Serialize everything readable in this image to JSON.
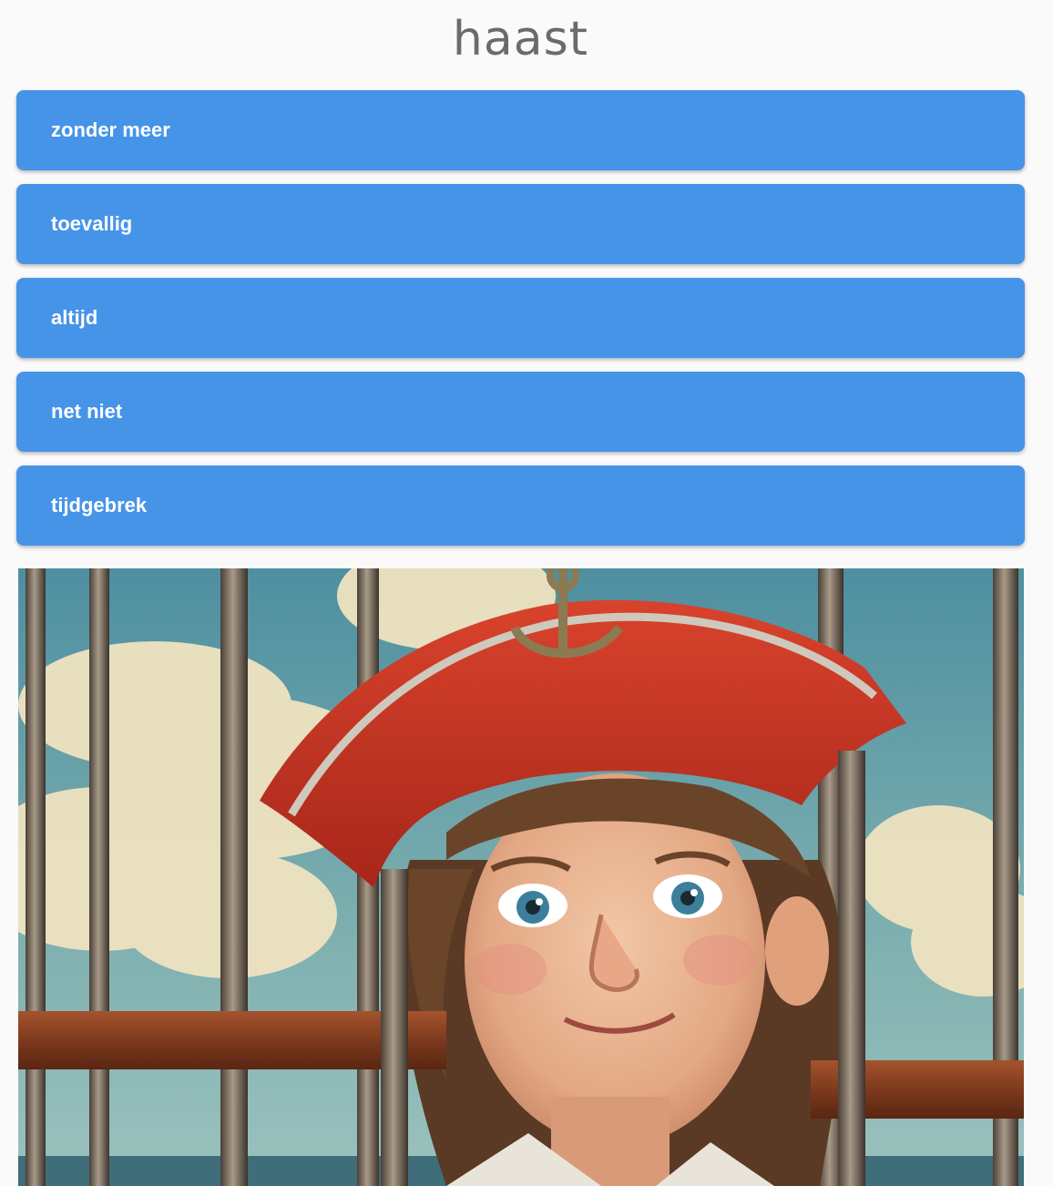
{
  "question": {
    "word": "haast"
  },
  "options": [
    {
      "label": "zonder meer"
    },
    {
      "label": "toevallig"
    },
    {
      "label": "altijd"
    },
    {
      "label": "net niet"
    },
    {
      "label": "tijdgebrek"
    }
  ],
  "colors": {
    "background": "#fafafa",
    "button": "#4694e8",
    "button_text": "#ffffff",
    "title": "#6b6b6b"
  },
  "illustration": {
    "subject": "pirate-child-behind-bars-icon"
  }
}
